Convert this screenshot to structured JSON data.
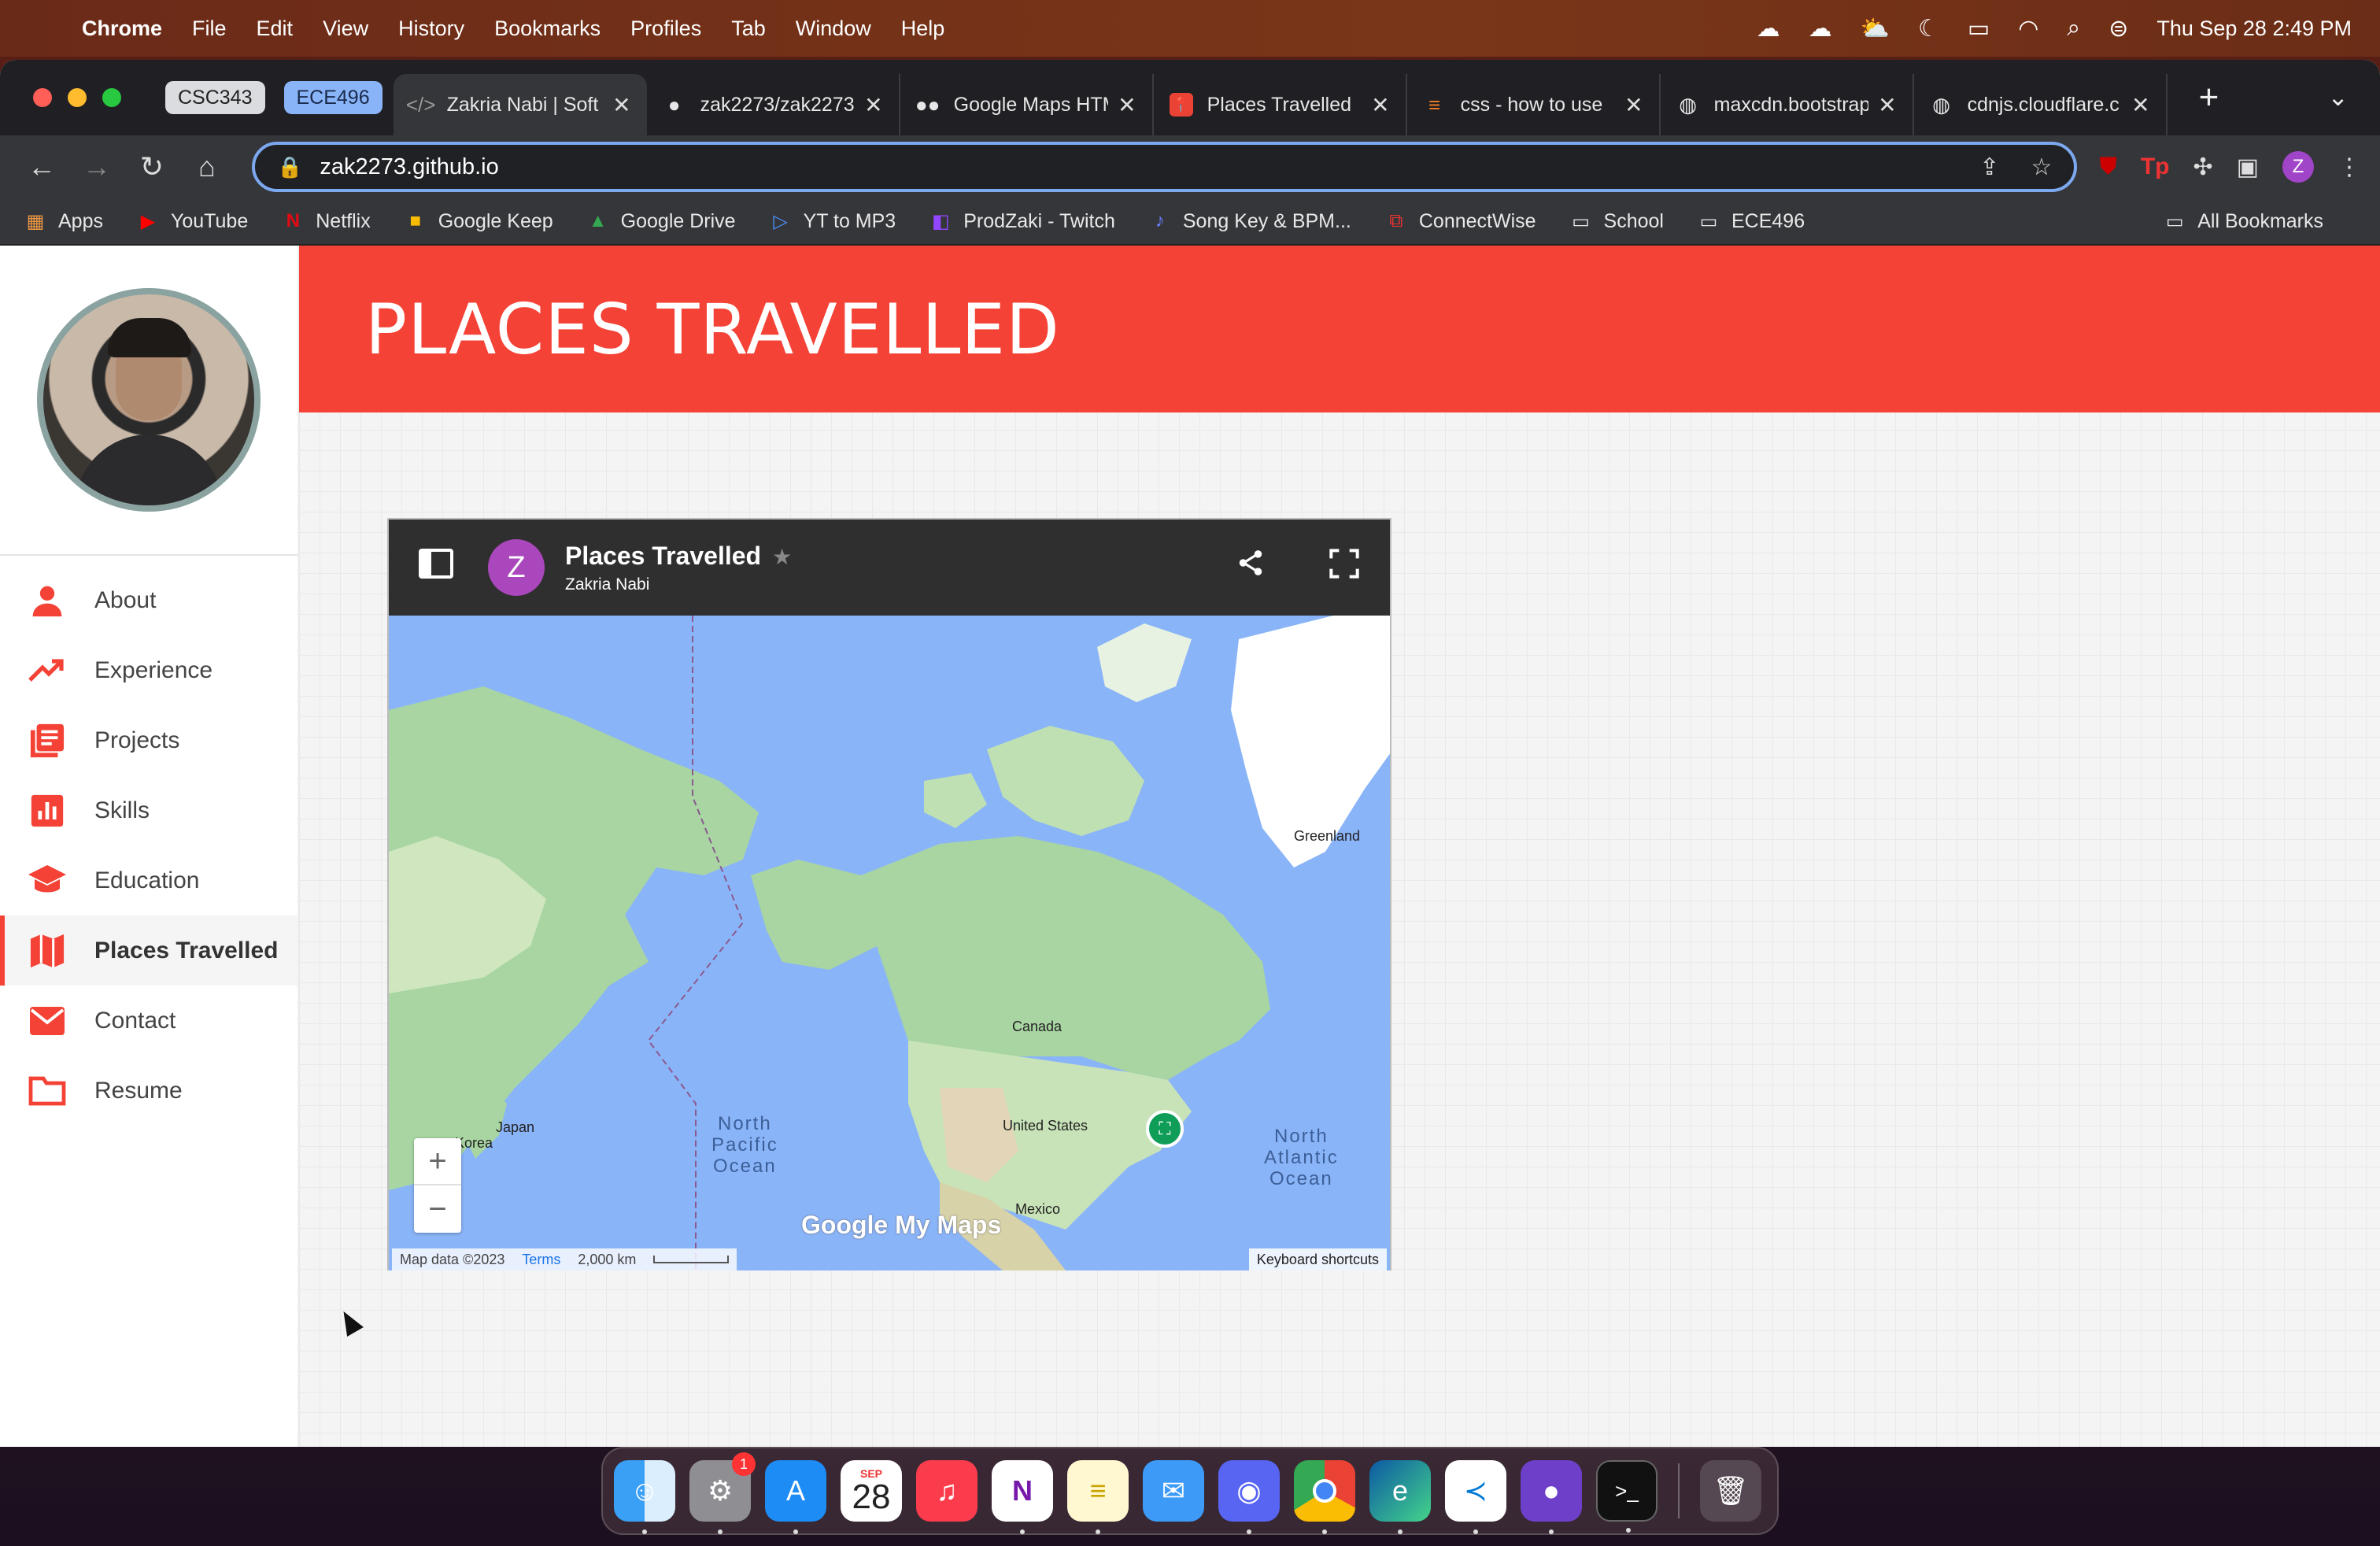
{
  "menubar": {
    "app": "Chrome",
    "items": [
      "File",
      "Edit",
      "View",
      "History",
      "Bookmarks",
      "Profiles",
      "Tab",
      "Window",
      "Help"
    ],
    "clock": "Thu Sep 28  2:49 PM"
  },
  "tab_groups": [
    "CSC343",
    "ECE496"
  ],
  "tabs": [
    {
      "title": "Zakria Nabi | Soft",
      "icon": "code-icon"
    },
    {
      "title": "zak2273/zak2273",
      "icon": "github-icon"
    },
    {
      "title": "Google Maps HTML",
      "icon": "medium-icon"
    },
    {
      "title": "Places Travelled",
      "icon": "maps-pin-icon"
    },
    {
      "title": "css - how to use",
      "icon": "stackoverflow-icon"
    },
    {
      "title": "maxcdn.bootstrap",
      "icon": "globe-icon"
    },
    {
      "title": "cdnjs.cloudflare.c",
      "icon": "globe-icon"
    }
  ],
  "address": {
    "url": "zak2273.github.io"
  },
  "profile_letter": "Z",
  "bookmarks": [
    {
      "label": "Apps",
      "icon": "apps-grid-icon"
    },
    {
      "label": "YouTube",
      "icon": "youtube-icon"
    },
    {
      "label": "Netflix",
      "icon": "netflix-icon"
    },
    {
      "label": "Google Keep",
      "icon": "keep-icon"
    },
    {
      "label": "Google Drive",
      "icon": "drive-icon"
    },
    {
      "label": "YT to MP3",
      "icon": "play-icon"
    },
    {
      "label": "ProdZaki - Twitch",
      "icon": "twitch-icon"
    },
    {
      "label": "Song Key & BPM...",
      "icon": "music-icon"
    },
    {
      "label": "ConnectWise",
      "icon": "connectwise-icon"
    },
    {
      "label": "School",
      "icon": "folder-icon"
    },
    {
      "label": "ECE496",
      "icon": "folder-icon"
    }
  ],
  "all_bookmarks": "All Bookmarks",
  "sidebar": {
    "items": [
      {
        "label": "About",
        "icon": "person-icon"
      },
      {
        "label": "Experience",
        "icon": "trending-up-icon"
      },
      {
        "label": "Projects",
        "icon": "list-icon"
      },
      {
        "label": "Skills",
        "icon": "bar-chart-icon"
      },
      {
        "label": "Education",
        "icon": "graduation-cap-icon"
      },
      {
        "label": "Places Travelled",
        "icon": "map-icon"
      },
      {
        "label": "Contact",
        "icon": "mail-icon"
      },
      {
        "label": "Resume",
        "icon": "folder-icon"
      }
    ],
    "active_index": 5
  },
  "page": {
    "title": "PLACES TRAVELLED",
    "accent": "#f44336"
  },
  "map": {
    "title": "Places Travelled",
    "owner": "Zakria Nabi",
    "avatar_letter": "Z",
    "labels": {
      "greenland": "Greenland",
      "canada": "Canada",
      "united_states": "United States",
      "mexico": "Mexico",
      "japan": "Japan",
      "korea": "Korea"
    },
    "oceans": {
      "pacific": [
        "North",
        "Pacific",
        "Ocean"
      ],
      "atlantic": [
        "North",
        "Atlantic",
        "Ocean"
      ]
    },
    "zoom_in": "+",
    "zoom_out": "−",
    "logo": "Google My Maps",
    "attribution": "Map data ©2023",
    "terms": "Terms",
    "scale": "2,000 km",
    "keyboard_shortcuts": "Keyboard shortcuts"
  },
  "dock": {
    "calendar_month": "SEP",
    "calendar_day": "28",
    "settings_badge": "1"
  }
}
